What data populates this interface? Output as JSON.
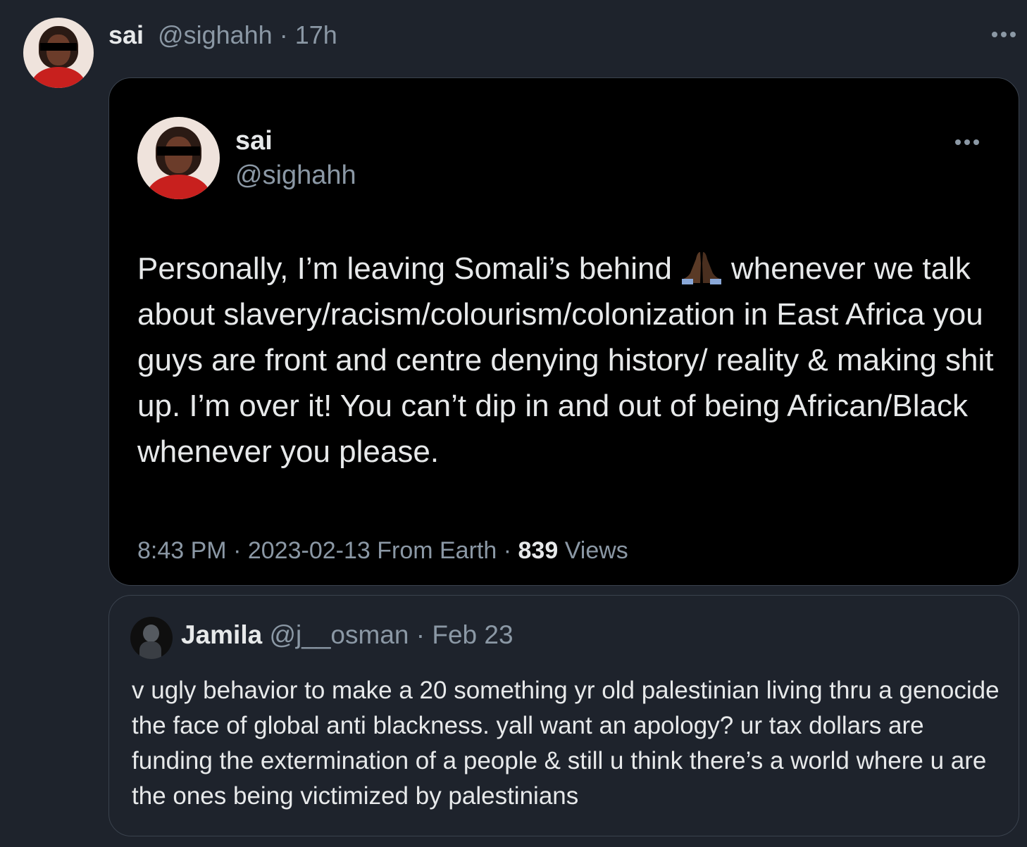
{
  "tweet": {
    "author_name": "sai",
    "author_handle": "@sighahh",
    "separator": "·",
    "time_ago": "17h"
  },
  "screenshot_card": {
    "author_name": "sai",
    "author_handle": "@sighahh",
    "text_before_emoji": "Personally, I’m leaving Somali’s behind",
    "emoji": "folded-hands-emoji",
    "text_after_emoji": "whenever we talk about slavery/racism/colourism/colonization in East Africa you guys are front and centre denying history/ reality & making shit up. I’m over it! You can’t dip in and out of being African/Black whenever you please.",
    "time": "8:43 PM",
    "separator": "·",
    "date": "2023-02-13",
    "source": "From Earth",
    "views_count": "839",
    "views_label": "Views"
  },
  "quoted_tweet": {
    "author_name": "Jamila",
    "author_handle": "@j__osman",
    "separator": "·",
    "date": "Feb 23",
    "text": "v ugly behavior to make a 20 something yr old palestinian living thru a genocide the face of global anti blackness. yall want an apology? ur tax dollars are funding the extermination of a people & still u think there’s a world where u are the ones being victimized by palestinians"
  },
  "icons": {
    "more": "more-horizontal-icon"
  },
  "colors": {
    "background": "#1e232c",
    "card_background": "#000000",
    "text": "#e7e9ea",
    "muted": "#8b98a5",
    "border": "#3a424d"
  }
}
